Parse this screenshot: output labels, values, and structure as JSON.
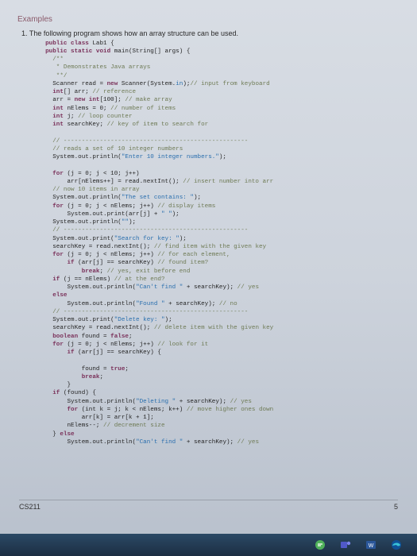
{
  "section_title": "Examples",
  "intro": "1.  The following program shows how an array structure can be used.",
  "code_lines": [
    {
      "indent": 2,
      "spans": [
        [
          "kw",
          "public class"
        ],
        [
          "ident",
          " Lab1 {"
        ]
      ]
    },
    {
      "indent": 2,
      "spans": [
        [
          "kw",
          "public static void"
        ],
        [
          "ident",
          " main(String[] args) {"
        ]
      ]
    },
    {
      "indent": 4,
      "spans": [
        [
          "cmt",
          "/**"
        ]
      ]
    },
    {
      "indent": 4,
      "spans": [
        [
          "cmt",
          " * Demonstrates Java arrays"
        ]
      ]
    },
    {
      "indent": 4,
      "spans": [
        [
          "cmt",
          " **/"
        ]
      ]
    },
    {
      "indent": 4,
      "spans": [
        [
          "ident",
          "Scanner read = "
        ],
        [
          "kw",
          "new"
        ],
        [
          "ident",
          " Scanner(System."
        ],
        [
          "str",
          "in"
        ],
        [
          "ident",
          ");"
        ],
        [
          "cmt",
          "// input from keyboard"
        ]
      ]
    },
    {
      "indent": 4,
      "spans": [
        [
          "kw",
          "int"
        ],
        [
          "ident",
          "[] arr; "
        ],
        [
          "cmt",
          "// reference"
        ]
      ]
    },
    {
      "indent": 4,
      "spans": [
        [
          "ident",
          "arr = "
        ],
        [
          "kw",
          "new int"
        ],
        [
          "ident",
          "[100]; "
        ],
        [
          "cmt",
          "// make array"
        ]
      ]
    },
    {
      "indent": 4,
      "spans": [
        [
          "kw",
          "int"
        ],
        [
          "ident",
          " nElems = 0; "
        ],
        [
          "cmt",
          "// number of items"
        ]
      ]
    },
    {
      "indent": 4,
      "spans": [
        [
          "kw",
          "int"
        ],
        [
          "ident",
          " j; "
        ],
        [
          "cmt",
          "// loop counter"
        ]
      ]
    },
    {
      "indent": 4,
      "spans": [
        [
          "kw",
          "int"
        ],
        [
          "ident",
          " searchKey; "
        ],
        [
          "cmt",
          "// key of item to search for"
        ]
      ]
    },
    {
      "indent": 0,
      "spans": [
        [
          "ident",
          ""
        ]
      ]
    },
    {
      "indent": 4,
      "spans": [
        [
          "cmt",
          "// ---------------------------------------------------"
        ]
      ]
    },
    {
      "indent": 4,
      "spans": [
        [
          "cmt",
          "// reads a set of 10 integer numbers"
        ]
      ]
    },
    {
      "indent": 4,
      "spans": [
        [
          "ident",
          "System.out.println("
        ],
        [
          "str",
          "\"Enter 10 integer numbers.\""
        ],
        [
          "ident",
          ");"
        ]
      ]
    },
    {
      "indent": 0,
      "spans": [
        [
          "ident",
          ""
        ]
      ]
    },
    {
      "indent": 4,
      "spans": [
        [
          "kw",
          "for"
        ],
        [
          "ident",
          " (j = 0; j < 10; j++)"
        ]
      ]
    },
    {
      "indent": 8,
      "spans": [
        [
          "ident",
          "arr[nElems++] = read.nextInt(); "
        ],
        [
          "cmt",
          "// insert number into arr"
        ]
      ]
    },
    {
      "indent": 4,
      "spans": [
        [
          "cmt",
          "// now 10 items in array"
        ]
      ]
    },
    {
      "indent": 4,
      "spans": [
        [
          "ident",
          "System.out.println("
        ],
        [
          "str",
          "\"The set contains: \""
        ],
        [
          "ident",
          ");"
        ]
      ]
    },
    {
      "indent": 4,
      "spans": [
        [
          "kw",
          "for"
        ],
        [
          "ident",
          " (j = 0; j < nElems; j++) "
        ],
        [
          "cmt",
          "// display items"
        ]
      ]
    },
    {
      "indent": 8,
      "spans": [
        [
          "ident",
          "System.out.print(arr[j] + "
        ],
        [
          "str",
          "\" \""
        ],
        [
          "ident",
          ");"
        ]
      ]
    },
    {
      "indent": 4,
      "spans": [
        [
          "ident",
          "System.out.println("
        ],
        [
          "str",
          "\"\""
        ],
        [
          "ident",
          ");"
        ]
      ]
    },
    {
      "indent": 4,
      "spans": [
        [
          "cmt",
          "// ---------------------------------------------------"
        ]
      ]
    },
    {
      "indent": 4,
      "spans": [
        [
          "ident",
          "System.out.print("
        ],
        [
          "str",
          "\"Search for key: \""
        ],
        [
          "ident",
          ");"
        ]
      ]
    },
    {
      "indent": 4,
      "spans": [
        [
          "ident",
          "searchKey = read.nextInt(); "
        ],
        [
          "cmt",
          "// find item with the given key"
        ]
      ]
    },
    {
      "indent": 4,
      "spans": [
        [
          "kw",
          "for"
        ],
        [
          "ident",
          " (j = 0; j < nElems; j++) "
        ],
        [
          "cmt",
          "// for each element,"
        ]
      ]
    },
    {
      "indent": 8,
      "spans": [
        [
          "kw",
          "if"
        ],
        [
          "ident",
          " (arr[j] == searchKey) "
        ],
        [
          "cmt",
          "// found item?"
        ]
      ]
    },
    {
      "indent": 12,
      "spans": [
        [
          "kw",
          "break"
        ],
        [
          "ident",
          "; "
        ],
        [
          "cmt",
          "// yes, exit before end"
        ]
      ]
    },
    {
      "indent": 4,
      "spans": [
        [
          "kw",
          "if"
        ],
        [
          "ident",
          " (j == nElems) "
        ],
        [
          "cmt",
          "// at the end?"
        ]
      ]
    },
    {
      "indent": 8,
      "spans": [
        [
          "ident",
          "System.out.println("
        ],
        [
          "str",
          "\"Can't find \""
        ],
        [
          "ident",
          " + searchKey); "
        ],
        [
          "cmt",
          "// yes"
        ]
      ]
    },
    {
      "indent": 4,
      "spans": [
        [
          "kw",
          "else"
        ]
      ]
    },
    {
      "indent": 8,
      "spans": [
        [
          "ident",
          "System.out.println("
        ],
        [
          "str",
          "\"Found \""
        ],
        [
          "ident",
          " + searchKey); "
        ],
        [
          "cmt",
          "// no"
        ]
      ]
    },
    {
      "indent": 4,
      "spans": [
        [
          "cmt",
          "// ---------------------------------------------------"
        ]
      ]
    },
    {
      "indent": 4,
      "spans": [
        [
          "ident",
          "System.out.print("
        ],
        [
          "str",
          "\"Delete key: \""
        ],
        [
          "ident",
          ");"
        ]
      ]
    },
    {
      "indent": 4,
      "spans": [
        [
          "ident",
          "searchKey = read.nextInt(); "
        ],
        [
          "cmt",
          "// delete item with the given key"
        ]
      ]
    },
    {
      "indent": 4,
      "spans": [
        [
          "kw",
          "boolean"
        ],
        [
          "ident",
          " found = "
        ],
        [
          "kw",
          "false"
        ],
        [
          "ident",
          ";"
        ]
      ]
    },
    {
      "indent": 4,
      "spans": [
        [
          "kw",
          "for"
        ],
        [
          "ident",
          " (j = 0; j < nElems; j++) "
        ],
        [
          "cmt",
          "// look for it"
        ]
      ]
    },
    {
      "indent": 8,
      "spans": [
        [
          "kw",
          "if"
        ],
        [
          "ident",
          " (arr[j] == searchKey) {"
        ]
      ]
    },
    {
      "indent": 0,
      "spans": [
        [
          "ident",
          ""
        ]
      ]
    },
    {
      "indent": 12,
      "spans": [
        [
          "ident",
          "found = "
        ],
        [
          "kw",
          "true"
        ],
        [
          "ident",
          ";"
        ]
      ]
    },
    {
      "indent": 12,
      "spans": [
        [
          "kw",
          "break"
        ],
        [
          "ident",
          ";"
        ]
      ]
    },
    {
      "indent": 8,
      "spans": [
        [
          "ident",
          "}"
        ]
      ]
    },
    {
      "indent": 4,
      "spans": [
        [
          "kw",
          "if"
        ],
        [
          "ident",
          " (found) {"
        ]
      ]
    },
    {
      "indent": 8,
      "spans": [
        [
          "ident",
          "System.out.println("
        ],
        [
          "str",
          "\"Deleting \""
        ],
        [
          "ident",
          " + searchKey); "
        ],
        [
          "cmt",
          "// yes"
        ]
      ]
    },
    {
      "indent": 8,
      "spans": [
        [
          "kw",
          "for"
        ],
        [
          "ident",
          " (int k = j; k < nElems; k++) "
        ],
        [
          "cmt",
          "// move higher ones down"
        ]
      ]
    },
    {
      "indent": 12,
      "spans": [
        [
          "ident",
          "arr[k] = arr[k + 1];"
        ]
      ]
    },
    {
      "indent": 8,
      "spans": [
        [
          "ident",
          "nElems--; "
        ],
        [
          "cmt",
          "// decrement size"
        ]
      ]
    },
    {
      "indent": 4,
      "spans": [
        [
          "ident",
          "} "
        ],
        [
          "kw",
          "else"
        ]
      ]
    },
    {
      "indent": 8,
      "spans": [
        [
          "ident",
          "System.out.println("
        ],
        [
          "str",
          "\"Can't find \""
        ],
        [
          "ident",
          " + searchKey); "
        ],
        [
          "cmt",
          "// yes"
        ]
      ]
    }
  ],
  "footer_left": "CS211",
  "footer_right": "5",
  "taskbar_icons": [
    "chat-icon",
    "teams-icon",
    "word-icon",
    "edge-icon"
  ]
}
